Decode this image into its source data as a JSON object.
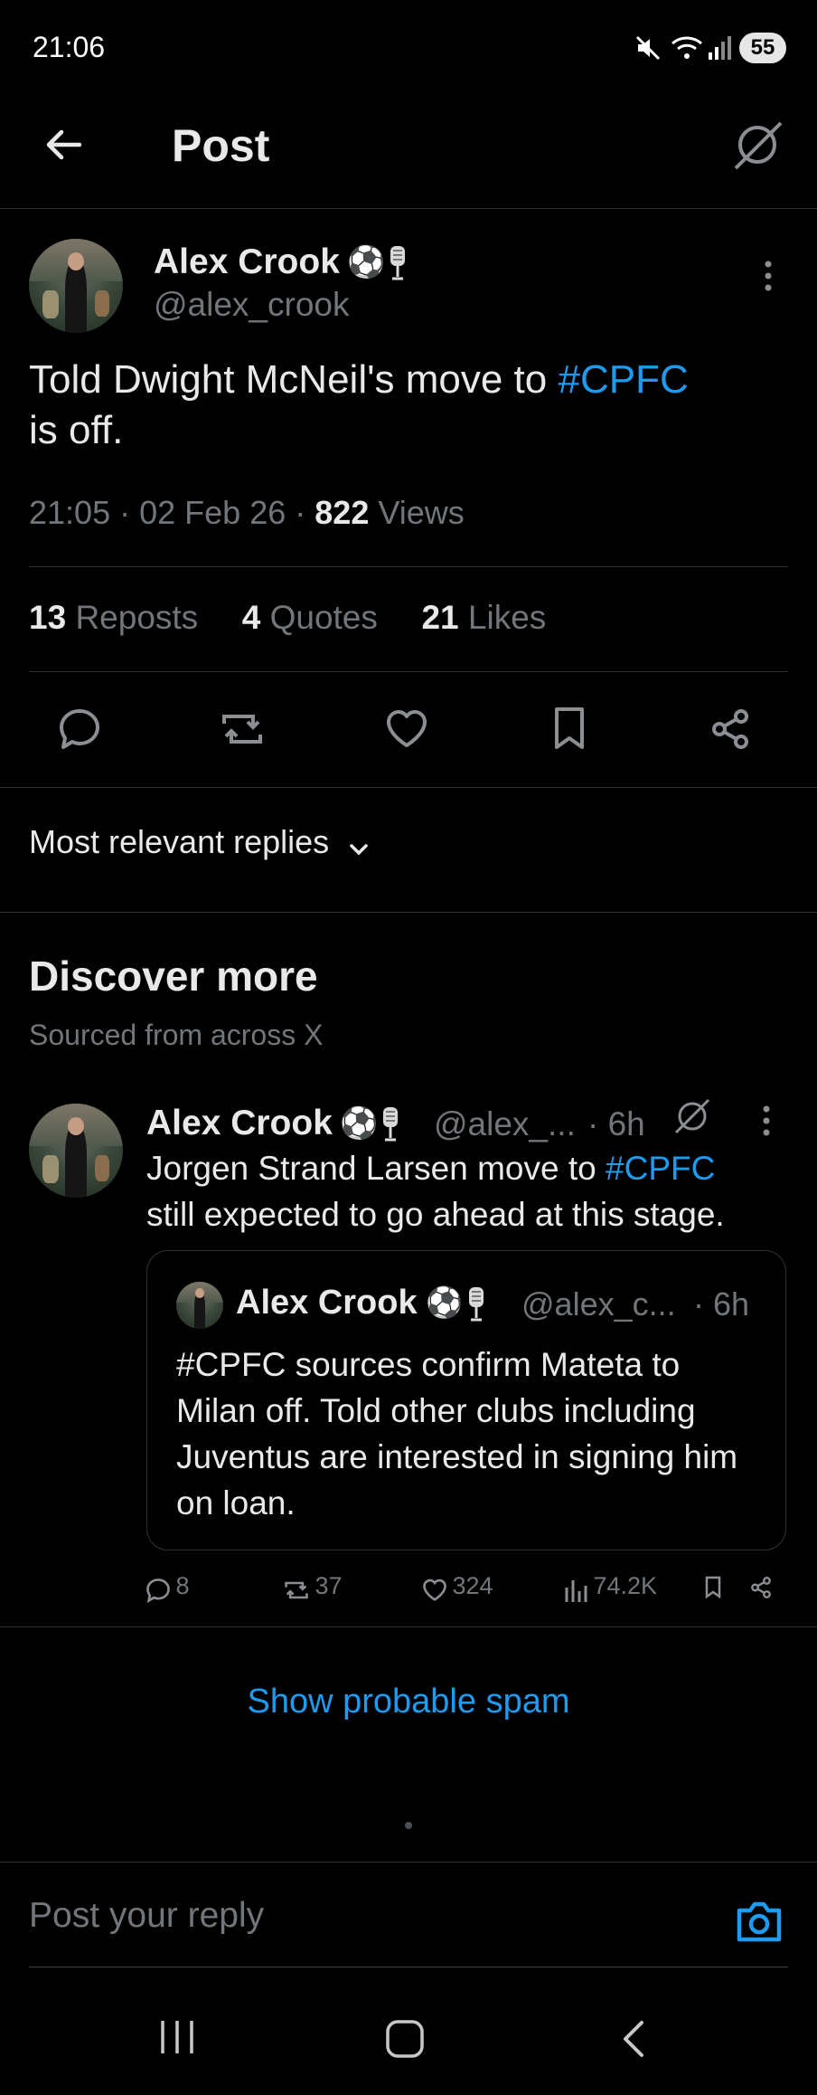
{
  "status_bar": {
    "time": "21:06",
    "battery": "55"
  },
  "header": {
    "title": "Post"
  },
  "post": {
    "author_name": "Alex Crook",
    "author_handle": "@alex_crook",
    "text_before": "Told Dwight McNeil's move to ",
    "hashtag": "#CPFC",
    "text_after": "is off.",
    "time": "21:05",
    "date": "02 Feb 26",
    "views_count": "822",
    "views_label": "Views",
    "reposts_count": "13",
    "reposts_label": "Reposts",
    "quotes_count": "4",
    "quotes_label": "Quotes",
    "likes_count": "21",
    "likes_label": "Likes",
    "dot": "·"
  },
  "replies_filter": {
    "label": "Most relevant replies"
  },
  "discover": {
    "title": "Discover more",
    "subtitle": "Sourced from across X"
  },
  "reply": {
    "author_name": "Alex Crook",
    "author_handle": "@alex_...",
    "age": "· 6h",
    "text_before": "Jorgen Strand Larsen move to ",
    "hashtag": "#CPFC",
    "text_after": "still expected to go ahead at this stage.",
    "quote": {
      "author_name": "Alex Crook",
      "author_handle": "@alex_c...",
      "age": "· 6h",
      "text": "#CPFC sources confirm Mateta to Milan off. Told other clubs including Juventus are interested in signing him on loan."
    },
    "replies": "8",
    "reposts": "37",
    "likes": "324",
    "views": "74.2K"
  },
  "show_spam": {
    "label": "Show probable spam"
  },
  "composer": {
    "placeholder": "Post your reply"
  },
  "colors": {
    "accent": "#1d9bf0",
    "background": "#000000",
    "muted": "#71767b",
    "divider": "#2f3336"
  }
}
